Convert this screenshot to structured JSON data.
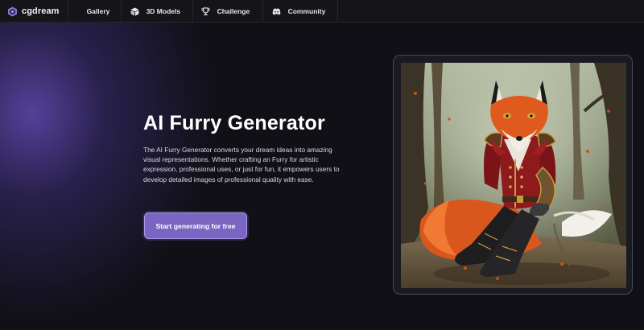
{
  "brand": {
    "name": "cgdream",
    "logo_icon": "cgdream-logo-icon"
  },
  "nav": {
    "items": [
      {
        "label": "Gallery",
        "icon": "gallery-grid-icon"
      },
      {
        "label": "3D Models",
        "icon": "cube-icon"
      },
      {
        "label": "Challenge",
        "icon": "trophy-icon"
      },
      {
        "label": "Community",
        "icon": "discord-icon"
      }
    ]
  },
  "hero": {
    "title": "AI Furry Generator",
    "description": "The AI Furry Generator converts your dream ideas into amazing visual representations. Whether crafting an Furry for artistic expression, professional uses, or just for fun, it empowers users to develop detailed images of professional quality with ease.",
    "cta_label": "Start generating for free"
  },
  "colors": {
    "accent": "#7a66c2",
    "accent_border": "#a99ae6",
    "background": "#101016",
    "glow": "#604ab2"
  }
}
